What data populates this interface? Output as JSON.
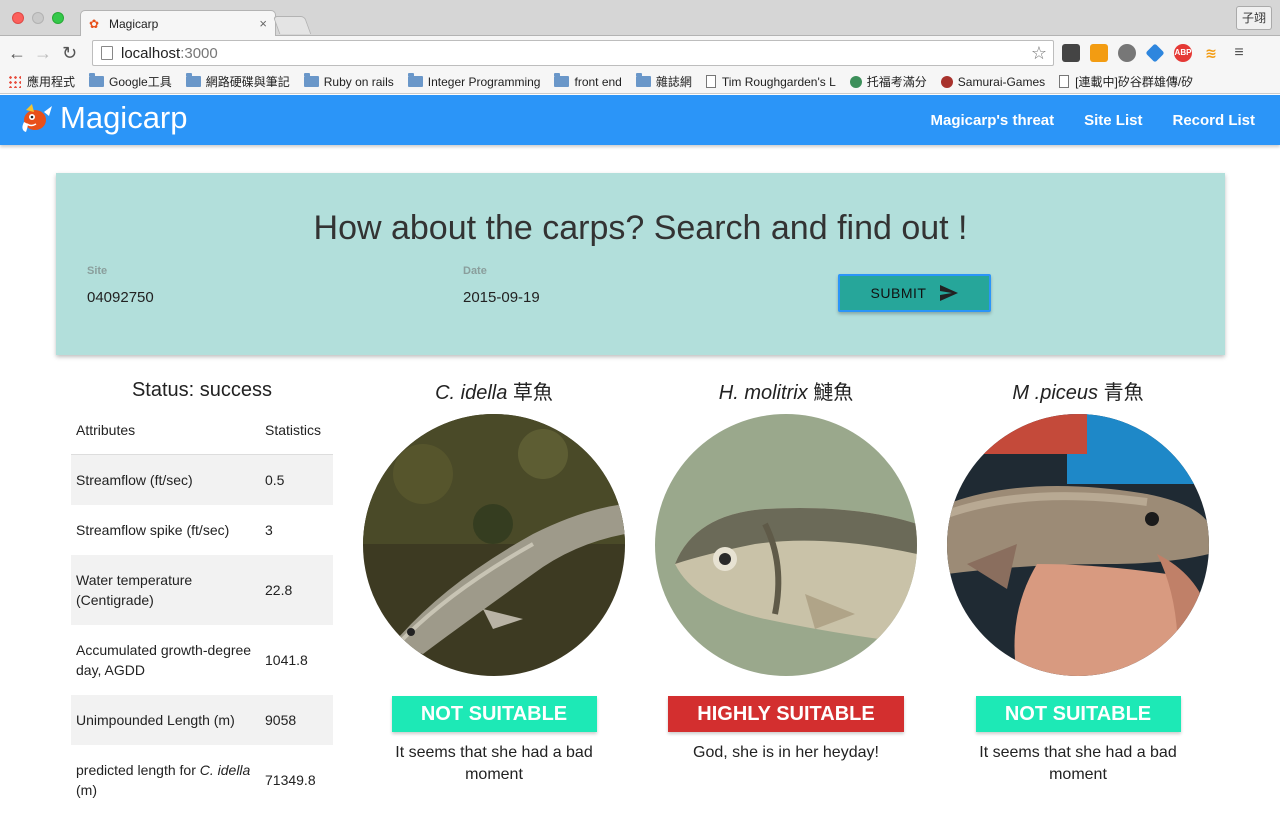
{
  "browser": {
    "tab_title": "Magicarp",
    "tab_close": "×",
    "profile": "子翊",
    "url_host": "localhost",
    "url_port": ":3000",
    "bookmarks": [
      {
        "label": "應用程式",
        "icon": "apps-icon"
      },
      {
        "label": "Google工具",
        "icon": "folder-icon"
      },
      {
        "label": "網路硬碟與筆記",
        "icon": "folder-icon"
      },
      {
        "label": "Ruby on rails",
        "icon": "folder-icon"
      },
      {
        "label": "Integer Programming",
        "icon": "folder-icon"
      },
      {
        "label": "front end",
        "icon": "folder-icon"
      },
      {
        "label": "雜誌網",
        "icon": "folder-icon"
      },
      {
        "label": "Tim Roughgarden's L",
        "icon": "page-icon"
      },
      {
        "label": "托福考滿分",
        "icon": "pin-icon"
      },
      {
        "label": "Samurai-Games",
        "icon": "samurai-icon"
      },
      {
        "label": "[連載中]矽谷群雄傳/矽",
        "icon": "page-icon"
      }
    ]
  },
  "nav": {
    "brand": "Magicarp",
    "links": [
      "Magicarp's threat",
      "Site List",
      "Record List"
    ]
  },
  "search": {
    "title": "How about the carps? Search and find out !",
    "site_label": "Site",
    "site_value": "04092750",
    "date_label": "Date",
    "date_value": "2015-09-19",
    "submit_label": "SUBMIT"
  },
  "stats": {
    "status": "Status: success",
    "header": [
      "Attributes",
      "Statistics"
    ],
    "rows": [
      {
        "attr": "Streamflow (ft/sec)",
        "value": "0.5"
      },
      {
        "attr": "Streamflow spike (ft/sec)",
        "value": "3"
      },
      {
        "attr": "Water temperature (Centigrade)",
        "value": "22.8"
      },
      {
        "attr": "Accumulated growth-degree day, AGDD",
        "value": "1041.8"
      },
      {
        "attr": "Unimpounded Length (m)",
        "value": "9058"
      },
      {
        "attr_prefix": "predicted length for ",
        "attr_italic": "C. idella",
        "attr_suffix": " (m)",
        "value": "71349.8"
      }
    ]
  },
  "fish": [
    {
      "sci": "C. idella",
      "cn": "草魚",
      "badge": "NOT SUITABLE",
      "message": "It seems that she had a bad moment"
    },
    {
      "sci": "H. molitrix",
      "cn": "鰱魚",
      "badge": "HIGHLY SUITABLE",
      "message": "God, she is in her heyday!"
    },
    {
      "sci": "M .piceus",
      "cn": "青魚",
      "badge": "NOT SUITABLE",
      "message": "It seems that she had a bad moment"
    }
  ],
  "colors": {
    "navbar": "#2b95f8",
    "search_card": "#b2dfdb",
    "submit": "#26a69a",
    "not_suitable": "#1de9b6",
    "highly_suitable": "#d32f2f"
  }
}
